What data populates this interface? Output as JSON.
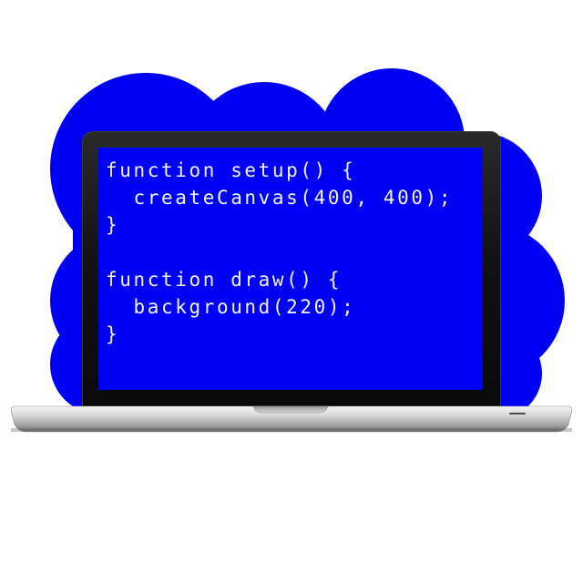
{
  "code": {
    "lines": [
      "function setup() {",
      "  createCanvas(400, 400);",
      "}",
      "",
      "function draw() {",
      "  background(220);",
      "}"
    ]
  },
  "colors": {
    "cloud": "#0000f5",
    "screen": "#0000f5",
    "code_text": "#f2f2f2",
    "laptop_bezel": "#111111",
    "laptop_base": "#c8c8c8"
  },
  "icons": {
    "laptop": "laptop-icon",
    "cloud": "cloud-shape"
  }
}
